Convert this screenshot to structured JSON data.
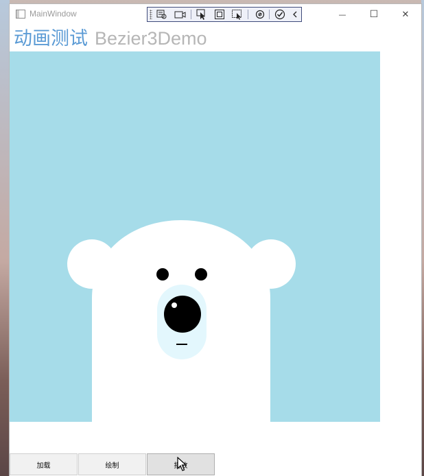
{
  "window": {
    "title": "MainWindow",
    "minimize_glyph": "—",
    "maximize_glyph": "☐",
    "close_glyph": "✕"
  },
  "debug_toolbar": {
    "icons": [
      "select-element-icon",
      "record-icon",
      "select-pointer-icon",
      "layout-adorner-icon",
      "track-focus-icon",
      "hot-reload-icon",
      "check-icon",
      "collapse-icon"
    ]
  },
  "heading": {
    "title_cn": "动画测试",
    "title_en": "Bezier3Demo"
  },
  "canvas": {
    "background": "#a6dce9",
    "bear_color": "#ffffff",
    "muzzle_color": "#e3f7fd",
    "nose_color": "#000000"
  },
  "buttons": [
    {
      "label": "加载"
    },
    {
      "label": "绘制"
    },
    {
      "label": "播放"
    }
  ]
}
